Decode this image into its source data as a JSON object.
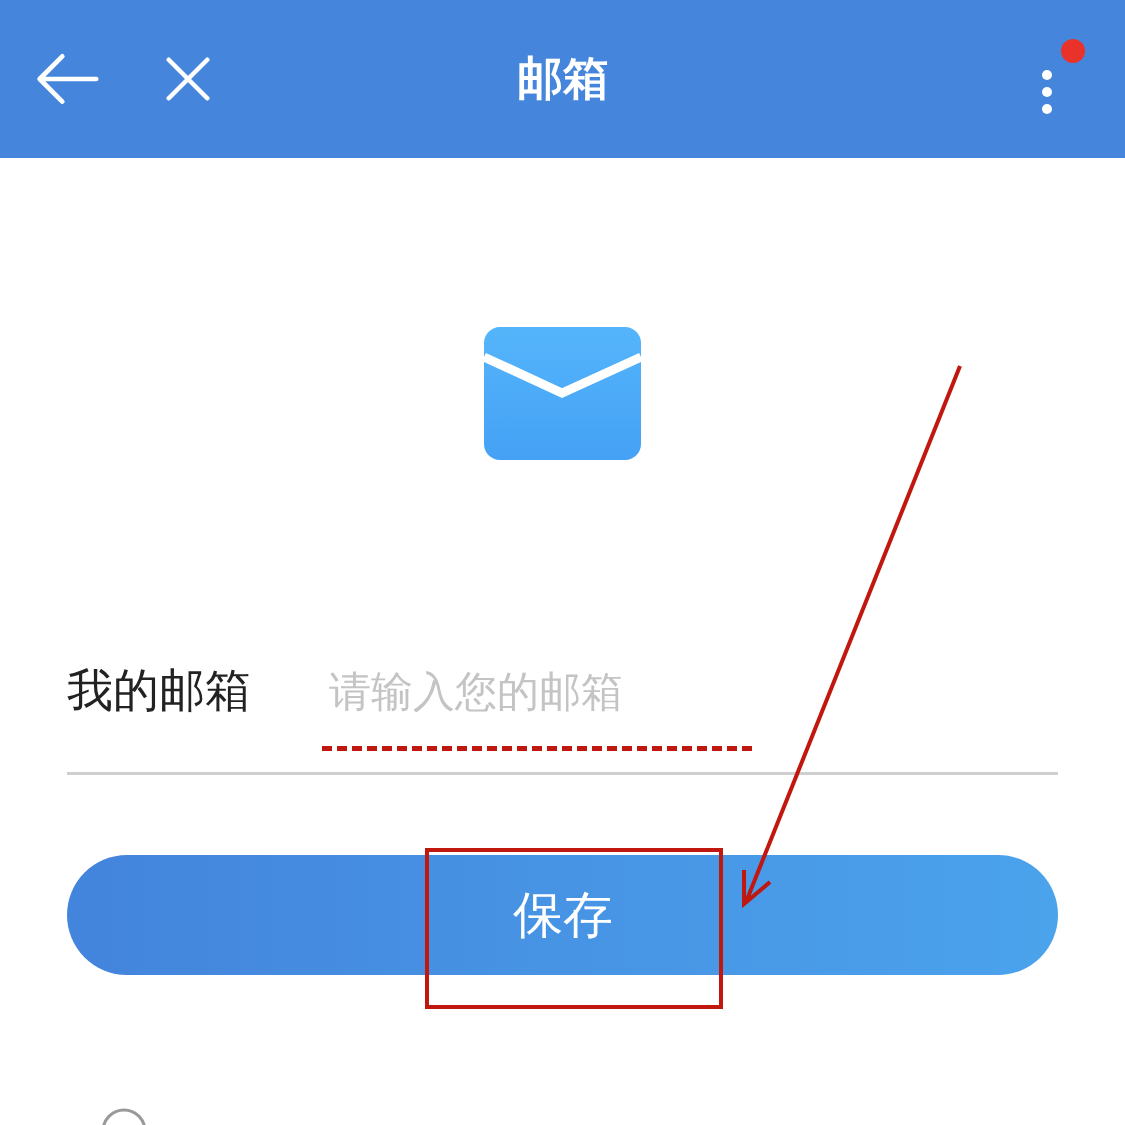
{
  "header": {
    "title": "邮箱",
    "notification_dot": true
  },
  "email_field": {
    "label": "我的邮箱",
    "placeholder": "请输入您的邮箱"
  },
  "save_button": {
    "label": "保存"
  }
}
